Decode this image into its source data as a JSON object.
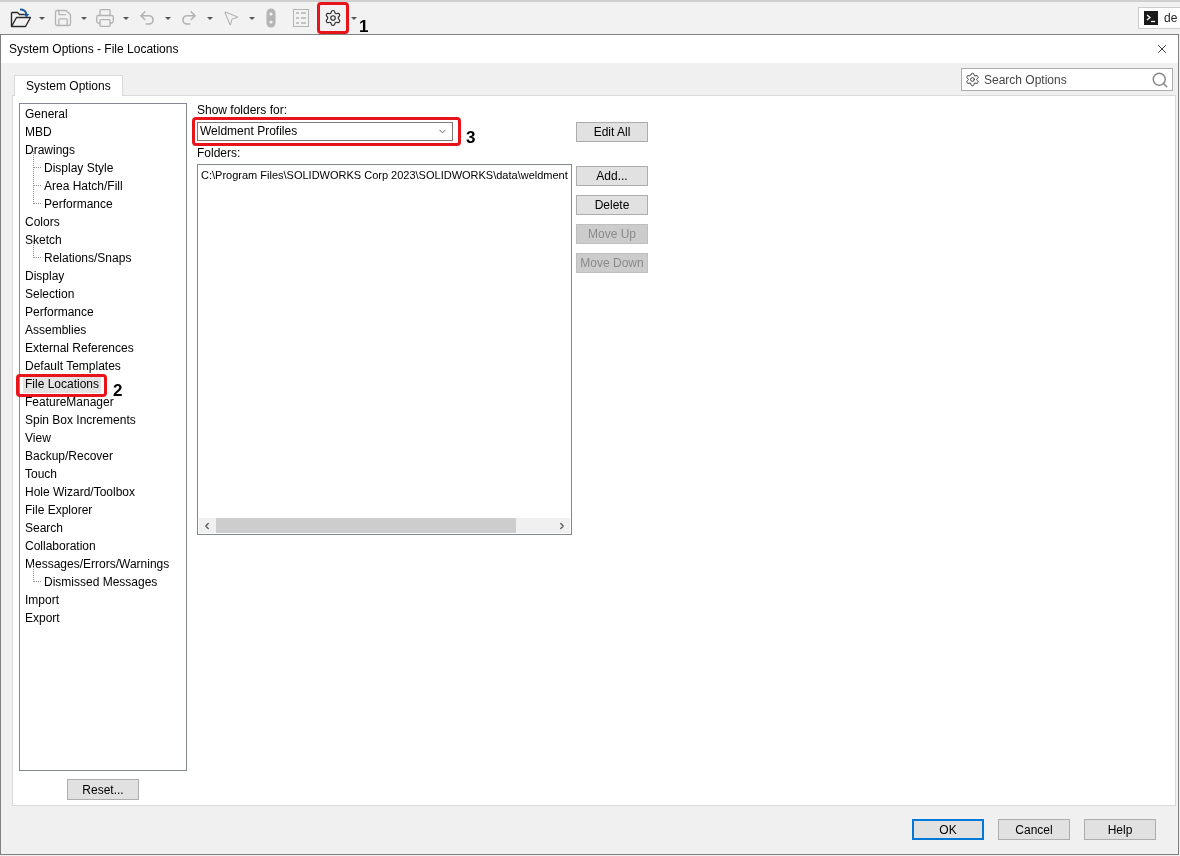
{
  "toolbar": {
    "tools": [
      {
        "kind": "open",
        "disabled": false,
        "menu": true
      },
      {
        "kind": "save",
        "disabled": true,
        "menu": true
      },
      {
        "kind": "print",
        "disabled": true,
        "menu": true
      },
      {
        "kind": "undo",
        "disabled": true,
        "menu": true
      },
      {
        "kind": "redo",
        "disabled": true,
        "menu": true
      },
      {
        "kind": "select",
        "disabled": true,
        "menu": true
      },
      {
        "kind": "rebuild",
        "disabled": true,
        "menu": false
      },
      {
        "kind": "file_properties",
        "disabled": true,
        "menu": false
      },
      {
        "kind": "options",
        "disabled": false,
        "menu": true,
        "callout": "1"
      }
    ],
    "terminal_tab": {
      "text": "de"
    }
  },
  "dialog": {
    "title": "System Options - File Locations",
    "tabs": [
      {
        "label": "System Options",
        "selected": true
      }
    ],
    "search": {
      "placeholder": "Search Options"
    },
    "tree": [
      {
        "label": "General",
        "selected": false
      },
      {
        "label": "MBD",
        "selected": false
      },
      {
        "label": "Drawings",
        "selected": false,
        "children": [
          {
            "label": "Display Style",
            "selected": false
          },
          {
            "label": "Area Hatch/Fill",
            "selected": false
          },
          {
            "label": "Performance",
            "selected": false
          }
        ]
      },
      {
        "label": "Colors",
        "selected": false
      },
      {
        "label": "Sketch",
        "selected": false,
        "children": [
          {
            "label": "Relations/Snaps",
            "selected": false
          }
        ]
      },
      {
        "label": "Display",
        "selected": false
      },
      {
        "label": "Selection",
        "selected": false
      },
      {
        "label": "Performance",
        "selected": false
      },
      {
        "label": "Assemblies",
        "selected": false
      },
      {
        "label": "External References",
        "selected": false
      },
      {
        "label": "Default Templates",
        "selected": false
      },
      {
        "label": "File Locations",
        "selected": true,
        "callout": "2"
      },
      {
        "label": "FeatureManager",
        "selected": false
      },
      {
        "label": "Spin Box Increments",
        "selected": false
      },
      {
        "label": "View",
        "selected": false
      },
      {
        "label": "Backup/Recover",
        "selected": false
      },
      {
        "label": "Touch",
        "selected": false
      },
      {
        "label": "Hole Wizard/Toolbox",
        "selected": false
      },
      {
        "label": "File Explorer",
        "selected": false
      },
      {
        "label": "Search",
        "selected": false
      },
      {
        "label": "Collaboration",
        "selected": false
      },
      {
        "label": "Messages/Errors/Warnings",
        "selected": false,
        "children": [
          {
            "label": "Dismissed Messages",
            "selected": false
          }
        ]
      },
      {
        "label": "Import",
        "selected": false
      },
      {
        "label": "Export",
        "selected": false
      }
    ],
    "reset_button": "Reset...",
    "show_folders_label": "Show folders for:",
    "folder_type": {
      "value": "Weldment Profiles",
      "callout": "3"
    },
    "folders_label": "Folders:",
    "folders": [
      "C:\\Program Files\\SOLIDWORKS Corp 2023\\SOLIDWORKS\\data\\weldment"
    ],
    "button_groups": [
      [
        {
          "label": "Edit All",
          "disabled": false
        }
      ],
      [
        {
          "label": "Add...",
          "disabled": false
        },
        {
          "label": "Delete",
          "disabled": false
        },
        {
          "label": "Move Up",
          "disabled": true
        },
        {
          "label": "Move Down",
          "disabled": true
        }
      ]
    ],
    "footer_buttons": [
      {
        "label": "OK",
        "default": true
      },
      {
        "label": "Cancel",
        "default": false
      },
      {
        "label": "Help",
        "default": false
      }
    ]
  }
}
